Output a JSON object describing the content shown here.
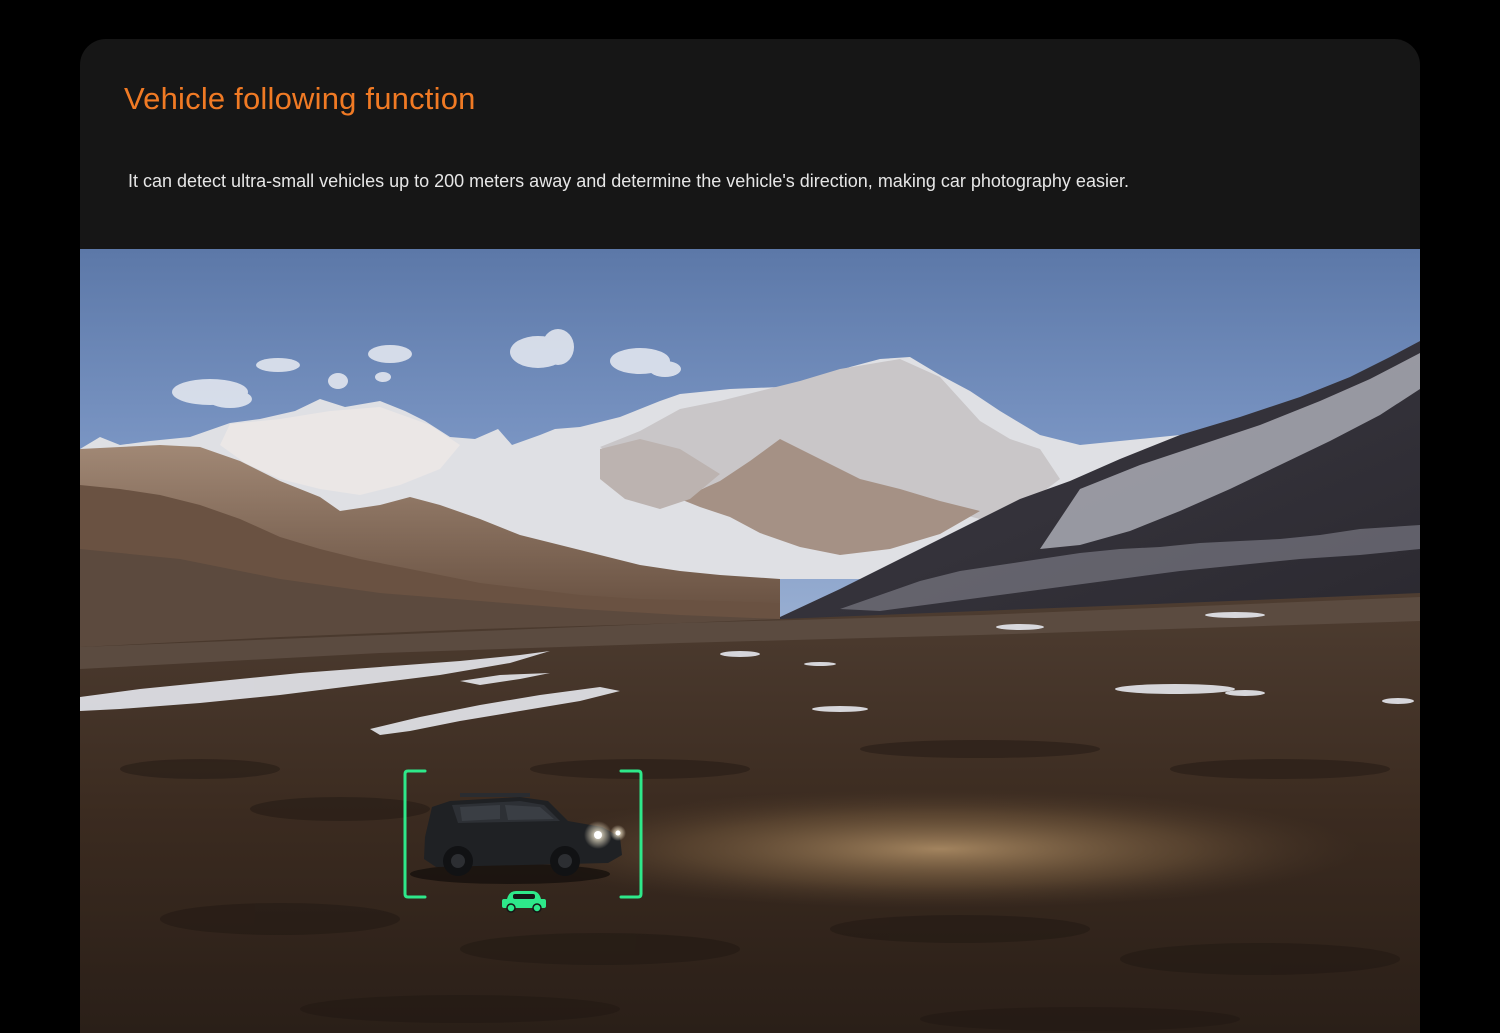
{
  "section": {
    "title": "Vehicle following function",
    "description": "It can detect ultra-small vehicles up to 200 meters away and determine the vehicle's direction, making car photography easier."
  },
  "scene": {
    "subject": "landscape-with-tracked-vehicle",
    "tracking_overlay": {
      "icon": "car-icon",
      "color": "#2ee88a"
    }
  },
  "colors": {
    "page_background": "#000000",
    "card_background": "#161616",
    "title": "#f07a24",
    "description": "#e6e6e6",
    "tracking_frame": "#2ee88a"
  }
}
